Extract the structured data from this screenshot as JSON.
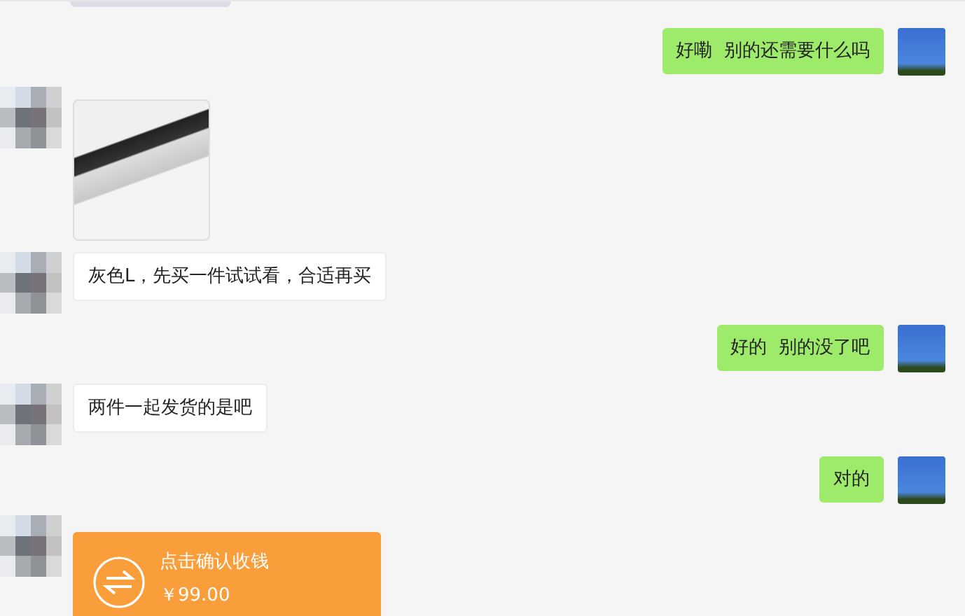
{
  "messages": [
    {
      "kind": "text",
      "outgoing": true,
      "text": "好嘞  别的还需要什么吗"
    },
    {
      "kind": "image",
      "outgoing": false
    },
    {
      "kind": "text",
      "outgoing": false,
      "text": "灰色L，先买一件试试看，合适再买"
    },
    {
      "kind": "text",
      "outgoing": true,
      "text": "好的  别的没了吧"
    },
    {
      "kind": "text",
      "outgoing": false,
      "text": "两件一起发货的是吧"
    },
    {
      "kind": "text",
      "outgoing": true,
      "text": "对的"
    },
    {
      "kind": "transfer",
      "outgoing": false,
      "title": "点击确认收钱",
      "amount": "￥99.00"
    }
  ]
}
